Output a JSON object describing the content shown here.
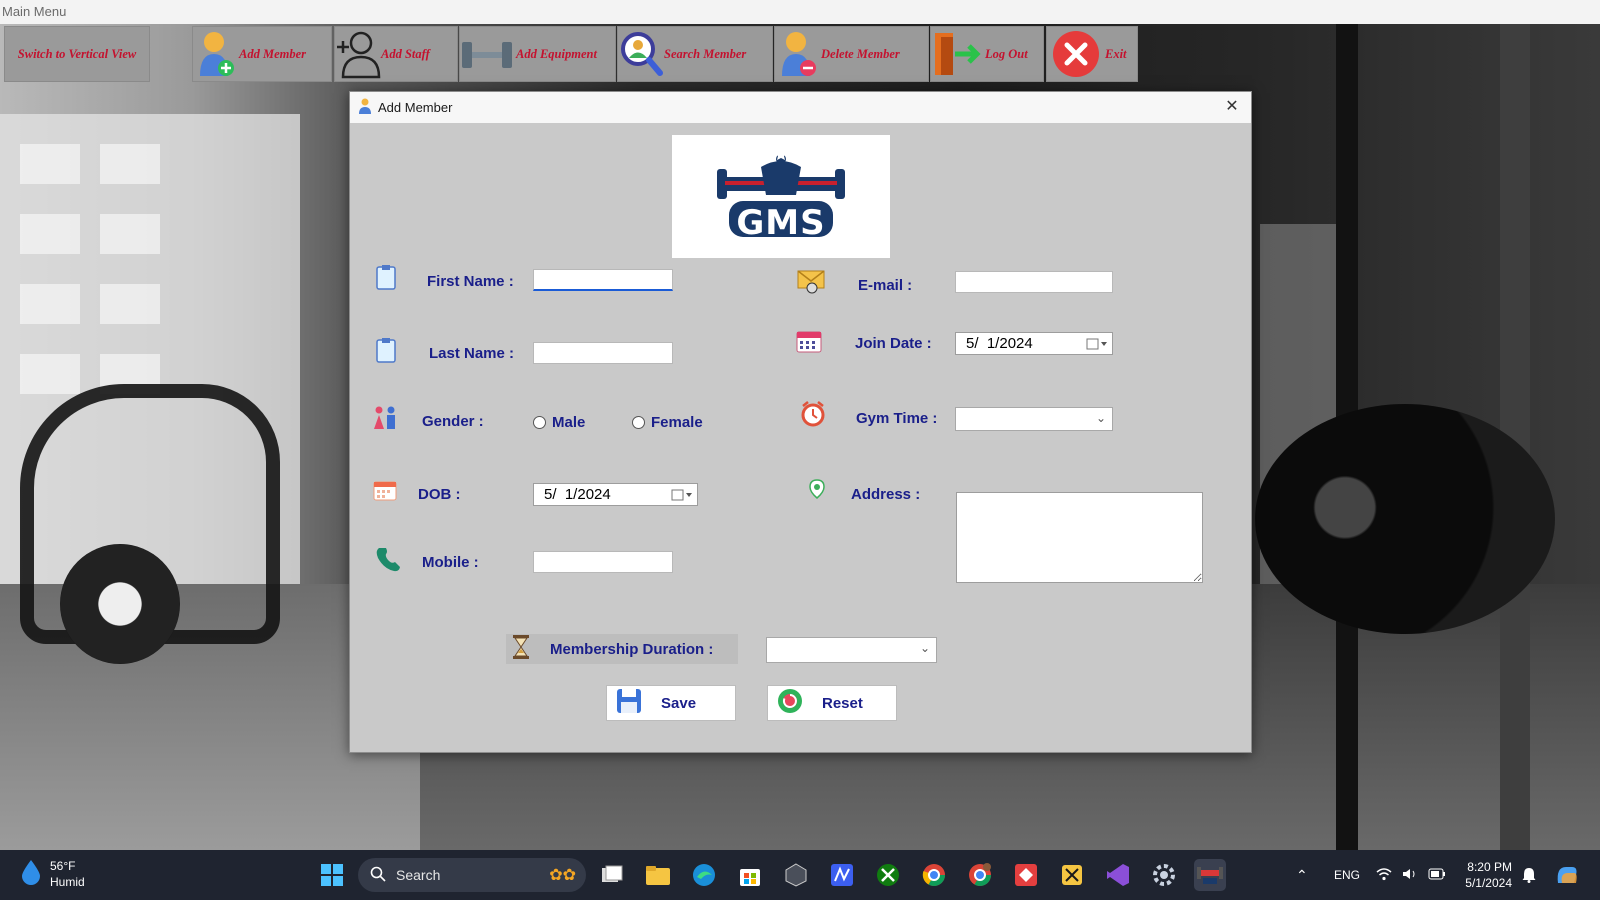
{
  "window": {
    "title": "Main Menu"
  },
  "toolbar": {
    "switch_view": "Switch to Vertical View",
    "add_member": "Add Member",
    "add_staff": "Add Staff",
    "add_equipment": "Add Equipment",
    "search_member": "Search Member",
    "delete_member": "Delete Member",
    "log_out": "Log Out",
    "exit": "Exit"
  },
  "dialog": {
    "title": "Add Member",
    "logo_text": "GMS",
    "fields": {
      "first_name_label": "First Name :",
      "first_name_value": "",
      "last_name_label": "Last Name :",
      "last_name_value": "",
      "gender_label": "Gender :",
      "gender_options": [
        "Male",
        "Female"
      ],
      "dob_label": "DOB :",
      "dob_value": "5/  1/2024",
      "mobile_label": "Mobile :",
      "mobile_value": "",
      "email_label": "E-mail :",
      "email_value": "",
      "join_date_label": "Join Date :",
      "join_date_value": "5/  1/2024",
      "gym_time_label": "Gym Time :",
      "gym_time_value": "",
      "address_label": "Address :",
      "address_value": "",
      "membership_duration_label": "Membership Duration :",
      "membership_duration_value": ""
    },
    "buttons": {
      "save": "Save",
      "reset": "Reset"
    }
  },
  "taskbar": {
    "weather_temp": "56°F",
    "weather_desc": "Humid",
    "search_label": "Search",
    "language": "ENG",
    "time": "8:20 PM",
    "date": "5/1/2024"
  },
  "colors": {
    "label_blue": "#1a1f8a",
    "toolbar_red": "#c4122f",
    "dialog_bg": "#c9c9c9"
  }
}
